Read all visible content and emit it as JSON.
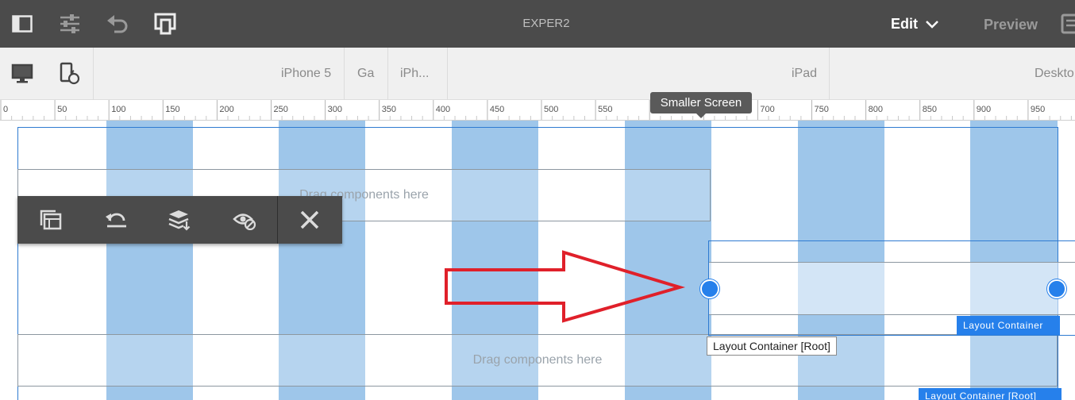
{
  "topbar": {
    "title": "EXPER2",
    "mode_edit": "Edit",
    "mode_preview": "Preview",
    "icons": [
      "side-panel-icon",
      "page-properties-icon",
      "undo-icon",
      "emulator-icon",
      "chevron-down-icon",
      "annotations-icon"
    ]
  },
  "devicebar": {
    "devices": [
      {
        "label": "iPhone 5"
      },
      {
        "label": "Ga"
      },
      {
        "label": "iPh..."
      },
      {
        "label": "iPad"
      },
      {
        "label": "Deskto"
      }
    ],
    "icons": [
      "desktop-icon",
      "rotate-device-icon"
    ]
  },
  "ruler": {
    "ticks": [
      "0",
      "50",
      "100",
      "150",
      "200",
      "250",
      "300",
      "350",
      "400",
      "450",
      "500",
      "550",
      "600",
      "650",
      "700",
      "750",
      "800",
      "850",
      "900",
      "950"
    ],
    "tooltip": "Smaller Screen"
  },
  "canvas": {
    "drop_text_1": "Drag components here",
    "drop_text_2": "Drag components here",
    "layout_badge": "Layout Container",
    "hover_label": "Layout Container [Root]",
    "root_badge": "Layout Container [Root]"
  },
  "toolbar": {
    "icons": [
      "parent-icon",
      "undo-layout-icon",
      "float-to-new-line-icon",
      "hide-component-icon",
      "close-icon"
    ]
  },
  "colors": {
    "topbar_bg": "#4b4b4b",
    "grid_column": "#9ec6ea",
    "accent_blue": "#2680eb",
    "arrow_red": "#e0202a"
  }
}
